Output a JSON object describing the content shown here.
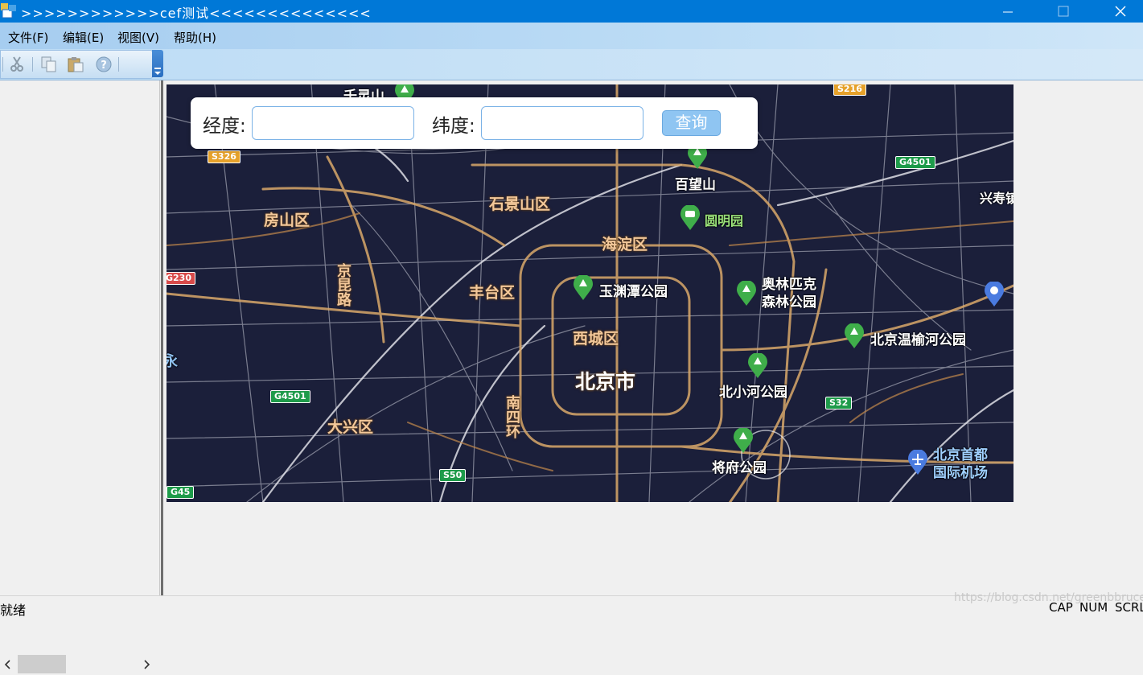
{
  "window": {
    "title": ">>>>>>>>>>>>cef测试<<<<<<<<<<<<<<",
    "minimize_icon": "minimize-icon",
    "maximize_icon": "maximize-icon",
    "close_icon": "close-icon"
  },
  "menu": {
    "items": [
      {
        "label": "文件(F)"
      },
      {
        "label": "编辑(E)"
      },
      {
        "label": "视图(V)"
      },
      {
        "label": "帮助(H)"
      }
    ]
  },
  "toolbar": {
    "buttons": [
      {
        "icon": "cut-icon"
      },
      {
        "icon": "copy-icon"
      },
      {
        "icon": "paste-icon"
      },
      {
        "icon": "help-icon"
      }
    ]
  },
  "search": {
    "longitude_label": "经度:",
    "longitude_value": "",
    "latitude_label": "纬度:",
    "latitude_value": "",
    "query_button": "查询"
  },
  "map": {
    "districts": [
      "房山区",
      "石景山区",
      "海淀区",
      "丰台区",
      "西城区",
      "大兴区"
    ],
    "city": "北京市",
    "roads": [
      "京昆路",
      "南四环"
    ],
    "pois": [
      "百望山",
      "圆明园",
      "玉渊潭公园",
      "奥林匹克森林公园",
      "北京温榆河公园",
      "北小河公园",
      "将府公园",
      "北京首都国际机场",
      "兴寿镇",
      "千灵山"
    ],
    "badges": [
      "S216",
      "G4501",
      "S326",
      "G230",
      "G4501",
      "S32",
      "S50",
      "G45"
    ],
    "partial": [
      "永"
    ]
  },
  "status": {
    "ready": "就绪",
    "cap": "CAP",
    "num": "NUM",
    "scrl": "SCRL",
    "watermark": "https://blog.csdn.net/greenbbruce"
  },
  "colors": {
    "titlebar": "#0078d7",
    "map_background": "#1b1f3a",
    "button": "#8fc5f2"
  }
}
